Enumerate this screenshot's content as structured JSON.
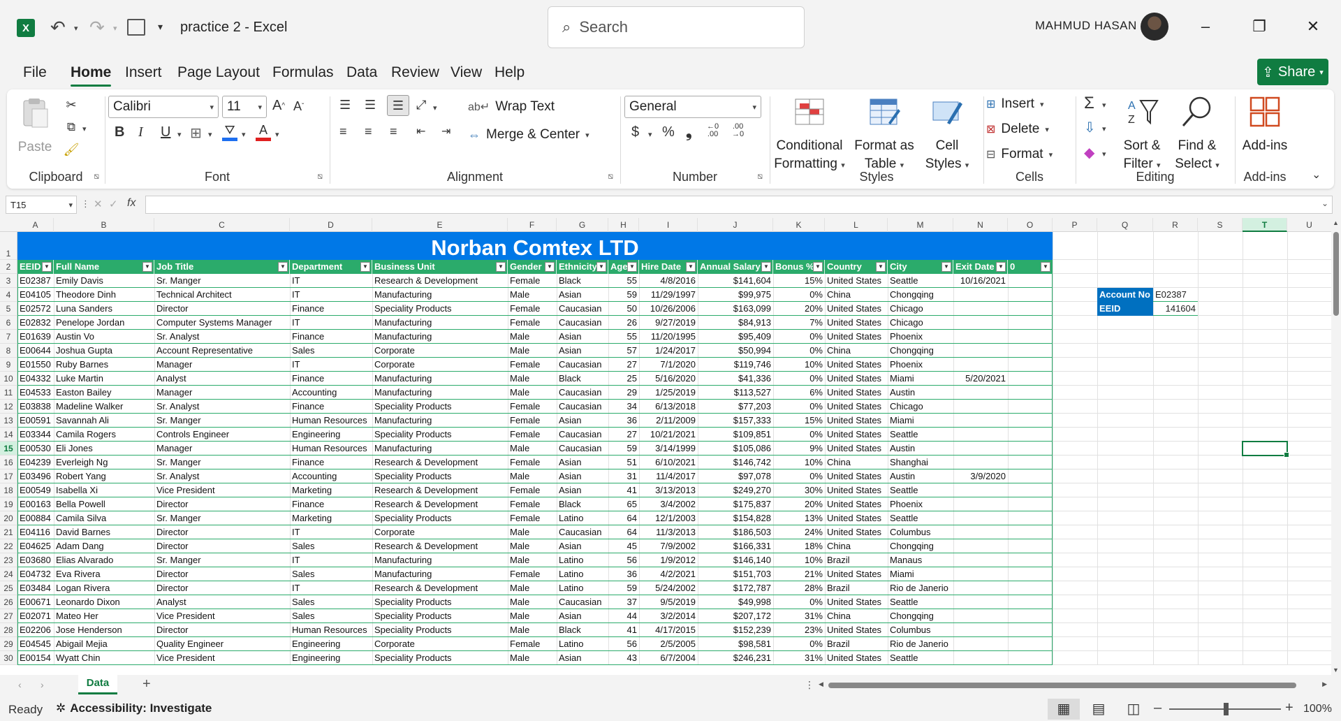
{
  "titlebar": {
    "app_logo": "X",
    "doc_title": "practice 2  -  Excel",
    "search_placeholder": "Search",
    "user_name": "MAHMUD HASAN",
    "minimize": "–",
    "maximize": "❐",
    "close": "✕"
  },
  "menu": {
    "tabs": [
      "File",
      "Home",
      "Insert",
      "Page Layout",
      "Formulas",
      "Data",
      "Review",
      "View",
      "Help"
    ],
    "active": "Home",
    "share_label": "Share"
  },
  "ribbon": {
    "clipboard": {
      "label": "Clipboard",
      "paste": "Paste"
    },
    "font": {
      "label": "Font",
      "font_name": "Calibri",
      "font_size": "11",
      "grow": "A^",
      "shrink": "Aˇ",
      "bold": "B",
      "italic": "I",
      "underline": "U"
    },
    "alignment": {
      "label": "Alignment",
      "wrap_text": "Wrap Text",
      "merge_center": "Merge & Center"
    },
    "number": {
      "label": "Number",
      "format": "General",
      "currency": "$",
      "percent": "%",
      "comma": "❟"
    },
    "styles": {
      "label": "Styles",
      "conditional_formatting": [
        "Conditional",
        "Formatting"
      ],
      "format_as_table": [
        "Format as",
        "Table"
      ],
      "cell_styles": [
        "Cell",
        "Styles"
      ]
    },
    "cells": {
      "label": "Cells",
      "insert": "Insert",
      "delete": "Delete",
      "format": "Format"
    },
    "editing": {
      "label": "Editing",
      "sort_filter": [
        "Sort &",
        "Filter"
      ],
      "find_select": [
        "Find &",
        "Select"
      ]
    },
    "addins": {
      "label": "Add-ins",
      "button": "Add-ins"
    }
  },
  "formula_bar": {
    "name_box": "T15",
    "fx": "fx",
    "formula": ""
  },
  "sheet": {
    "columns": [
      "A",
      "B",
      "C",
      "D",
      "E",
      "F",
      "G",
      "H",
      "I",
      "J",
      "K",
      "L",
      "M",
      "N",
      "O",
      "P",
      "Q",
      "R",
      "S",
      "T",
      "U"
    ],
    "selected_column": "T",
    "row_numbers": [
      "1",
      "2",
      "3",
      "4",
      "5",
      "6",
      "7",
      "8",
      "9",
      "10",
      "11",
      "12",
      "13",
      "14",
      "15",
      "16",
      "17",
      "18",
      "19",
      "20",
      "21",
      "22",
      "23",
      "24",
      "25",
      "26",
      "27",
      "28",
      "29",
      "30"
    ],
    "banner_title": "Norban Comtex LTD",
    "table_headers": [
      "EEID",
      "Full Name",
      "Job Title",
      "Department",
      "Business Unit",
      "Gender",
      "Ethnicity",
      "Age",
      "Hire Date",
      "Annual Salary",
      "Bonus %",
      "Country",
      "City",
      "Exit Date",
      "0"
    ],
    "rows": [
      [
        "E02387",
        "Emily Davis",
        "Sr. Manger",
        "IT",
        "Research & Development",
        "Female",
        "Black",
        "55",
        "4/8/2016",
        "$141,604",
        "15%",
        "United States",
        "Seattle",
        "10/16/2021",
        ""
      ],
      [
        "E04105",
        "Theodore Dinh",
        "Technical Architect",
        "IT",
        "Manufacturing",
        "Male",
        "Asian",
        "59",
        "11/29/1997",
        "$99,975",
        "0%",
        "China",
        "Chongqing",
        "",
        ""
      ],
      [
        "E02572",
        "Luna Sanders",
        "Director",
        "Finance",
        "Speciality Products",
        "Female",
        "Caucasian",
        "50",
        "10/26/2006",
        "$163,099",
        "20%",
        "United States",
        "Chicago",
        "",
        ""
      ],
      [
        "E02832",
        "Penelope Jordan",
        "Computer Systems Manager",
        "IT",
        "Manufacturing",
        "Female",
        "Caucasian",
        "26",
        "9/27/2019",
        "$84,913",
        "7%",
        "United States",
        "Chicago",
        "",
        ""
      ],
      [
        "E01639",
        "Austin Vo",
        "Sr. Analyst",
        "Finance",
        "Manufacturing",
        "Male",
        "Asian",
        "55",
        "11/20/1995",
        "$95,409",
        "0%",
        "United States",
        "Phoenix",
        "",
        ""
      ],
      [
        "E00644",
        "Joshua Gupta",
        "Account Representative",
        "Sales",
        "Corporate",
        "Male",
        "Asian",
        "57",
        "1/24/2017",
        "$50,994",
        "0%",
        "China",
        "Chongqing",
        "",
        ""
      ],
      [
        "E01550",
        "Ruby Barnes",
        "Manager",
        "IT",
        "Corporate",
        "Female",
        "Caucasian",
        "27",
        "7/1/2020",
        "$119,746",
        "10%",
        "United States",
        "Phoenix",
        "",
        ""
      ],
      [
        "E04332",
        "Luke Martin",
        "Analyst",
        "Finance",
        "Manufacturing",
        "Male",
        "Black",
        "25",
        "5/16/2020",
        "$41,336",
        "0%",
        "United States",
        "Miami",
        "5/20/2021",
        ""
      ],
      [
        "E04533",
        "Easton Bailey",
        "Manager",
        "Accounting",
        "Manufacturing",
        "Male",
        "Caucasian",
        "29",
        "1/25/2019",
        "$113,527",
        "6%",
        "United States",
        "Austin",
        "",
        ""
      ],
      [
        "E03838",
        "Madeline Walker",
        "Sr. Analyst",
        "Finance",
        "Speciality Products",
        "Female",
        "Caucasian",
        "34",
        "6/13/2018",
        "$77,203",
        "0%",
        "United States",
        "Chicago",
        "",
        ""
      ],
      [
        "E00591",
        "Savannah Ali",
        "Sr. Manger",
        "Human Resources",
        "Manufacturing",
        "Female",
        "Asian",
        "36",
        "2/11/2009",
        "$157,333",
        "15%",
        "United States",
        "Miami",
        "",
        ""
      ],
      [
        "E03344",
        "Camila Rogers",
        "Controls Engineer",
        "Engineering",
        "Speciality Products",
        "Female",
        "Caucasian",
        "27",
        "10/21/2021",
        "$109,851",
        "0%",
        "United States",
        "Seattle",
        "",
        ""
      ],
      [
        "E00530",
        "Eli Jones",
        "Manager",
        "Human Resources",
        "Manufacturing",
        "Male",
        "Caucasian",
        "59",
        "3/14/1999",
        "$105,086",
        "9%",
        "United States",
        "Austin",
        "",
        ""
      ],
      [
        "E04239",
        "Everleigh Ng",
        "Sr. Manger",
        "Finance",
        "Research & Development",
        "Female",
        "Asian",
        "51",
        "6/10/2021",
        "$146,742",
        "10%",
        "China",
        "Shanghai",
        "",
        ""
      ],
      [
        "E03496",
        "Robert Yang",
        "Sr. Analyst",
        "Accounting",
        "Speciality Products",
        "Male",
        "Asian",
        "31",
        "11/4/2017",
        "$97,078",
        "0%",
        "United States",
        "Austin",
        "3/9/2020",
        ""
      ],
      [
        "E00549",
        "Isabella Xi",
        "Vice President",
        "Marketing",
        "Research & Development",
        "Female",
        "Asian",
        "41",
        "3/13/2013",
        "$249,270",
        "30%",
        "United States",
        "Seattle",
        "",
        ""
      ],
      [
        "E00163",
        "Bella Powell",
        "Director",
        "Finance",
        "Research & Development",
        "Female",
        "Black",
        "65",
        "3/4/2002",
        "$175,837",
        "20%",
        "United States",
        "Phoenix",
        "",
        ""
      ],
      [
        "E00884",
        "Camila Silva",
        "Sr. Manger",
        "Marketing",
        "Speciality Products",
        "Female",
        "Latino",
        "64",
        "12/1/2003",
        "$154,828",
        "13%",
        "United States",
        "Seattle",
        "",
        ""
      ],
      [
        "E04116",
        "David Barnes",
        "Director",
        "IT",
        "Corporate",
        "Male",
        "Caucasian",
        "64",
        "11/3/2013",
        "$186,503",
        "24%",
        "United States",
        "Columbus",
        "",
        ""
      ],
      [
        "E04625",
        "Adam Dang",
        "Director",
        "Sales",
        "Research & Development",
        "Male",
        "Asian",
        "45",
        "7/9/2002",
        "$166,331",
        "18%",
        "China",
        "Chongqing",
        "",
        ""
      ],
      [
        "E03680",
        "Elias Alvarado",
        "Sr. Manger",
        "IT",
        "Manufacturing",
        "Male",
        "Latino",
        "56",
        "1/9/2012",
        "$146,140",
        "10%",
        "Brazil",
        "Manaus",
        "",
        ""
      ],
      [
        "E04732",
        "Eva Rivera",
        "Director",
        "Sales",
        "Manufacturing",
        "Female",
        "Latino",
        "36",
        "4/2/2021",
        "$151,703",
        "21%",
        "United States",
        "Miami",
        "",
        ""
      ],
      [
        "E03484",
        "Logan Rivera",
        "Director",
        "IT",
        "Research & Development",
        "Male",
        "Latino",
        "59",
        "5/24/2002",
        "$172,787",
        "28%",
        "Brazil",
        "Rio de Janerio",
        "",
        ""
      ],
      [
        "E00671",
        "Leonardo Dixon",
        "Analyst",
        "Sales",
        "Speciality Products",
        "Male",
        "Caucasian",
        "37",
        "9/5/2019",
        "$49,998",
        "0%",
        "United States",
        "Seattle",
        "",
        ""
      ],
      [
        "E02071",
        "Mateo Her",
        "Vice President",
        "Sales",
        "Speciality Products",
        "Male",
        "Asian",
        "44",
        "3/2/2014",
        "$207,172",
        "31%",
        "China",
        "Chongqing",
        "",
        ""
      ],
      [
        "E02206",
        "Jose Henderson",
        "Director",
        "Human Resources",
        "Speciality Products",
        "Male",
        "Black",
        "41",
        "4/17/2015",
        "$152,239",
        "23%",
        "United States",
        "Columbus",
        "",
        ""
      ],
      [
        "E04545",
        "Abigail Mejia",
        "Quality Engineer",
        "Engineering",
        "Corporate",
        "Female",
        "Latino",
        "56",
        "2/5/2005",
        "$98,581",
        "0%",
        "Brazil",
        "Rio de Janerio",
        "",
        ""
      ],
      [
        "E00154",
        "Wyatt Chin",
        "Vice President",
        "Engineering",
        "Speciality Products",
        "Male",
        "Asian",
        "43",
        "6/7/2004",
        "$246,231",
        "31%",
        "United States",
        "Seattle",
        "",
        ""
      ]
    ],
    "lookup": {
      "account_label": "Account No",
      "account_value": "E02387",
      "eeid_label": "EEID",
      "eeid_value": "141604"
    }
  },
  "sheet_tabs": {
    "active": "Data",
    "add": "+"
  },
  "status": {
    "ready": "Ready",
    "accessibility": "Accessibility: Investigate",
    "zoom": "100%"
  }
}
